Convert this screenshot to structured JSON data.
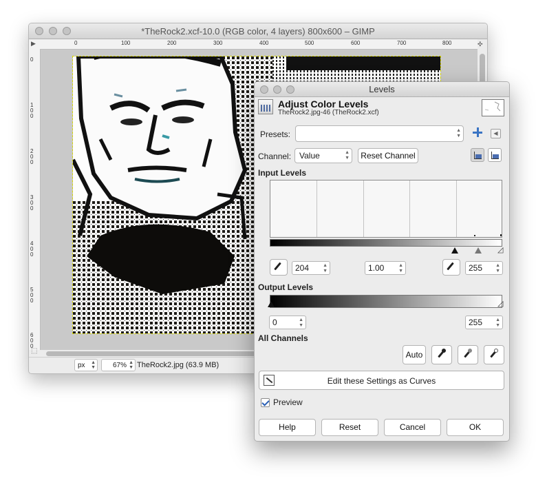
{
  "main_window": {
    "title": "*TheRock2.xcf-10.0 (RGB color, 4 layers) 800x600 – GIMP",
    "ruler_h_labels": [
      "0",
      "100",
      "200",
      "300",
      "400",
      "500",
      "600",
      "700",
      "800"
    ],
    "ruler_v_labels": [
      "0",
      "100",
      "200",
      "300",
      "400",
      "500",
      "600"
    ],
    "status": {
      "unit": "px",
      "zoom": "67%",
      "info": "TheRock2.jpg (63.9 MB)"
    }
  },
  "levels_dialog": {
    "window_title": "Levels",
    "header_title": "Adjust Color Levels",
    "header_subtitle": "TheRock2.jpg-46 (TheRock2.xcf)",
    "presets_label": "Presets:",
    "presets_value": "",
    "channel_label": "Channel:",
    "channel_value": "Value",
    "reset_channel_label": "Reset Channel",
    "input_levels_label": "Input Levels",
    "input_low": "204",
    "input_gamma": "1.00",
    "input_high": "255",
    "output_levels_label": "Output Levels",
    "output_low": "0",
    "output_high": "255",
    "all_channels_label": "All Channels",
    "auto_label": "Auto",
    "edit_curves_label": "Edit these Settings as Curves",
    "preview_label": "Preview",
    "preview_checked": true,
    "buttons": {
      "help": "Help",
      "reset": "Reset",
      "cancel": "Cancel",
      "ok": "OK"
    }
  },
  "colors": {
    "accent_blue": "#3a74c4",
    "title_text": "#555555"
  }
}
